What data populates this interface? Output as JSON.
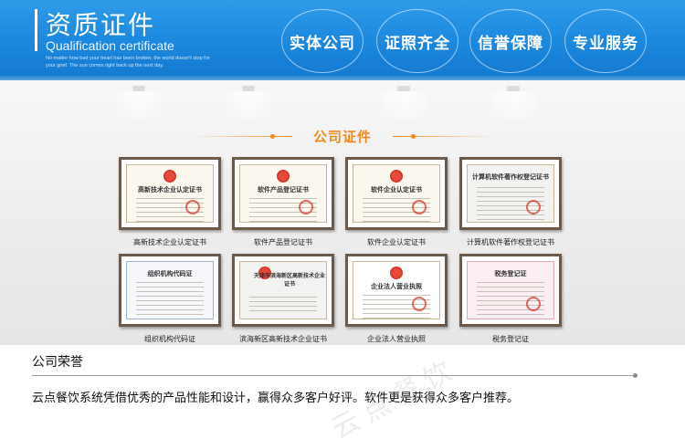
{
  "header": {
    "title_cn": "资质证件",
    "title_en": "Qualification certificate",
    "subtitle": "No matter how bad your heart has been broken, the world doesn't stop for your grief. The sun comes right back up the next day.",
    "badges": [
      "实体公司",
      "证照齐全",
      "信誉保障",
      "专业服务"
    ]
  },
  "gallery": {
    "section_title": "公司证件",
    "certificates": [
      {
        "caption": "高新技术企业认定证书",
        "head": "高新技术企业认定证书"
      },
      {
        "caption": "软件产品登记证书",
        "head": "软件产品登记证书"
      },
      {
        "caption": "软件企业认定证书",
        "head": "软件企业认定证书"
      },
      {
        "caption": "计算机软件著作权登记证书",
        "head": "计算机软件著作权登记证书"
      },
      {
        "caption": "组织机构代码证",
        "head": "组织机构代码证"
      },
      {
        "caption": "滨海新区高新技术企业证书",
        "head": "天津市滨海新区高新技术企业证书"
      },
      {
        "caption": "企业法人营业执照",
        "head": "企业法人营业执照"
      },
      {
        "caption": "税务登记证",
        "head": "税务登记证"
      }
    ]
  },
  "honors": {
    "title": "公司荣誉",
    "text": "云点餐饮系统凭借优秀的产品性能和设计，赢得众多客户好评。软件更是获得众多客户推荐。",
    "watermark": "云点餐饮"
  }
}
